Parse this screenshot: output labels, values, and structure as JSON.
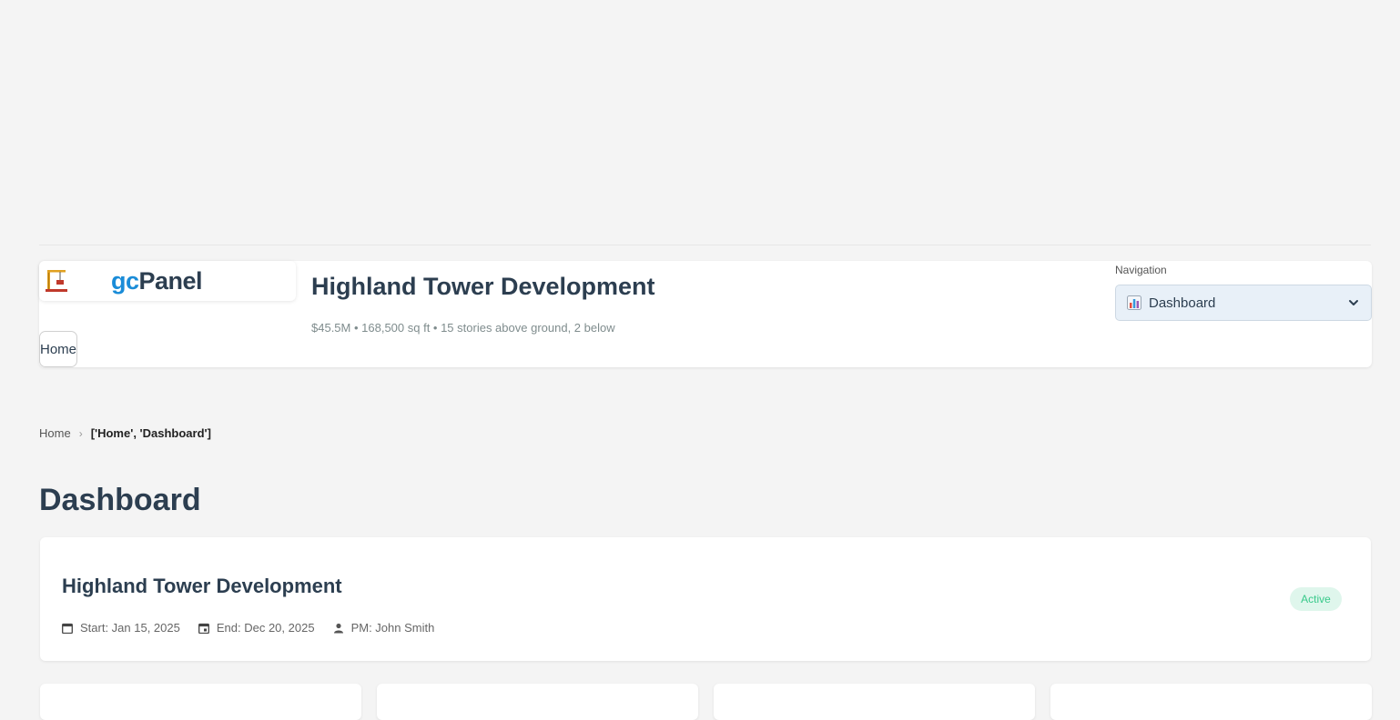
{
  "brand": {
    "prefix": "gc",
    "suffix": "Panel"
  },
  "header": {
    "home_label": "Home",
    "project_title": "Highland Tower Development",
    "project_subtitle": "$45.5M • 168,500 sq ft • 15 stories above ground, 2 below",
    "nav_label": "Navigation",
    "nav_selected": "Dashboard",
    "nav_icon": "bar-chart-icon"
  },
  "breadcrumb": {
    "home": "Home",
    "separator": "›",
    "current": "['Home', 'Dashboard']"
  },
  "page": {
    "title": "Dashboard"
  },
  "project_card": {
    "title": "Highland Tower Development",
    "start": "Start: Jan 15, 2025",
    "end": "End: Dec 20, 2025",
    "pm": "PM: John Smith",
    "status": "Active",
    "status_color": "#38c98a"
  },
  "colors": {
    "accent": "#1a8cd8",
    "text": "#2c3e50",
    "background": "#f4f4f4"
  }
}
